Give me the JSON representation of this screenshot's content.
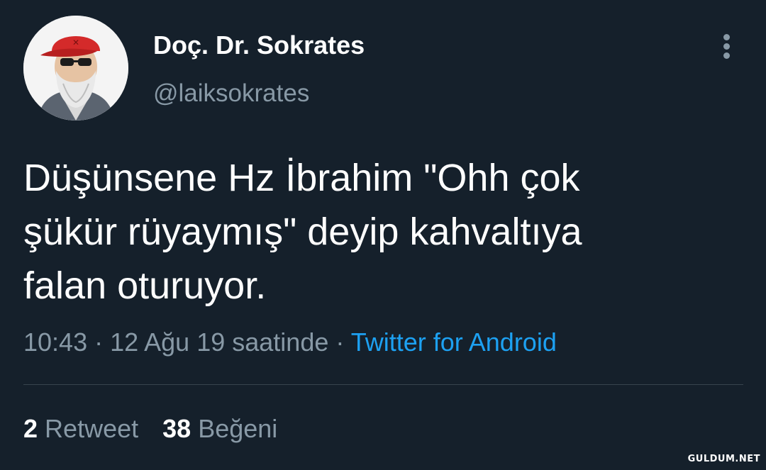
{
  "user": {
    "display_name": "Doç. Dr. Sokrates",
    "username": "@laiksokrates"
  },
  "tweet": {
    "text": "Düşünsene Hz İbrahim \"Ohh çok\nşükür rüyaymış\" deyip kahvaltıya\nfalan oturuyor.",
    "time": "10:43",
    "date": "12 Ağu 19 saatinde",
    "separator": " · ",
    "source": "Twitter for Android"
  },
  "stats": {
    "retweet_count": "2",
    "retweet_label": "Retweet",
    "like_count": "38",
    "like_label": "Beğeni"
  },
  "icons": {
    "more": "more-vertical-icon"
  },
  "colors": {
    "background": "#15202b",
    "secondary_text": "#8899a6",
    "link": "#1da1f2",
    "divider": "#38444d"
  },
  "watermark": "GULDUM.NET"
}
